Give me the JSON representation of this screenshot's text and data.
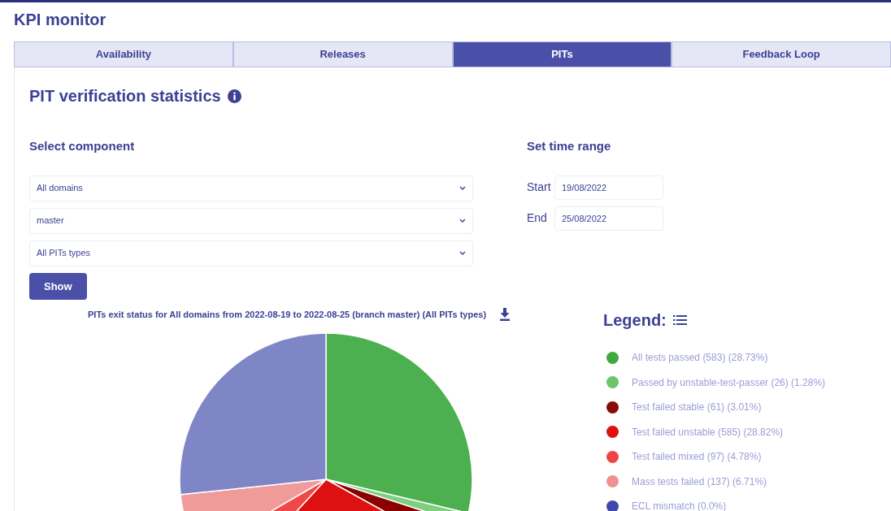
{
  "app_title": "KPI monitor",
  "tabs": [
    {
      "label": "Availability",
      "selected": false
    },
    {
      "label": "Releases",
      "selected": false
    },
    {
      "label": "PITs",
      "selected": true
    },
    {
      "label": "Feedback Loop",
      "selected": false
    }
  ],
  "heading": "PIT verification statistics",
  "component": {
    "title": "Select component",
    "selects": [
      {
        "value": "All domains"
      },
      {
        "value": "master"
      },
      {
        "value": "All PITs types"
      }
    ],
    "button": "Show"
  },
  "time_range": {
    "title": "Set time range",
    "fields": [
      {
        "label": "Start",
        "value": "19/08/2022"
      },
      {
        "label": "End",
        "value": "25/08/2022"
      }
    ]
  },
  "chart_data": {
    "type": "pie",
    "title": "PITs exit status for All domains from 2022-08-19 to 2022-08-25 (branch master) (All PITs types)",
    "values": [
      28.73,
      1.28,
      3.01,
      28.82,
      4.78,
      6.71,
      26.67
    ],
    "colors": [
      "#4caf50",
      "#7fcf7f",
      "#8b0000",
      "#dd1111",
      "#f04848",
      "#f19a9a",
      "#7f86c6"
    ]
  },
  "legend": {
    "title": "Legend:",
    "items": [
      {
        "label": "All tests passed (583) (28.73%)",
        "color": "#3fa83f"
      },
      {
        "label": "Passed by unstable-test-passer (26) (1.28%)",
        "color": "#6cc46c"
      },
      {
        "label": "Test failed stable (61) (3.01%)",
        "color": "#8b0a0a"
      },
      {
        "label": "Test failed unstable (585) (28.82%)",
        "color": "#e01010"
      },
      {
        "label": "Test failed mixed (97) (4.78%)",
        "color": "#ee4444"
      },
      {
        "label": "Mass tests failed (137) (6.71%)",
        "color": "#f09090"
      },
      {
        "label": "ECL mismatch (0.0%)",
        "color": "#3f48a8"
      }
    ]
  }
}
